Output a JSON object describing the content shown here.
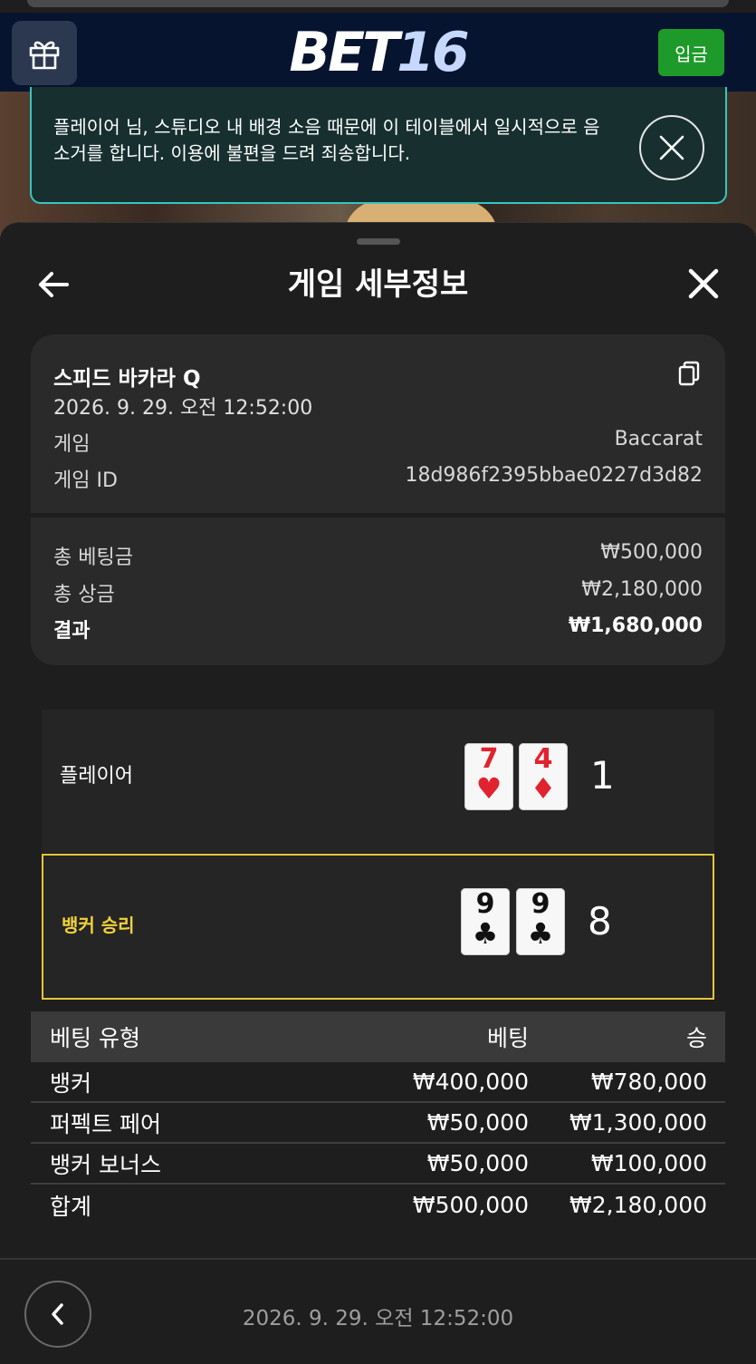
{
  "header": {
    "logo_left": "BET",
    "logo_right": "16",
    "deposit_label": "입금"
  },
  "notice": {
    "text": "플레이어 님, 스튜디오 내 배경 소음 때문에 이 테이블에서 일시적으로 음소거를 합니다. 이용에 불편을 드려 죄송합니다."
  },
  "sheet": {
    "title": "게임 세부정보"
  },
  "summary": {
    "game_name": "스피드 바카라 Q",
    "datetime": "2026. 9. 29. 오전 12:52:00",
    "game_label": "게임",
    "game_value": "Baccarat",
    "id_label": "게임 ID",
    "id_value": "18d986f2395bbae0227d3d82",
    "total_bet_label": "총 베팅금",
    "total_bet_value": "₩500,000",
    "total_win_label": "총 상금",
    "total_win_value": "₩2,180,000",
    "result_label": "결과",
    "result_value": "₩1,680,000"
  },
  "hands": {
    "player": {
      "label": "플레이어",
      "cards": [
        {
          "rank": "7",
          "suit": "♥"
        },
        {
          "rank": "4",
          "suit": "♦"
        }
      ],
      "score": "1"
    },
    "banker": {
      "label": "뱅커 승리",
      "cards": [
        {
          "rank": "9",
          "suit": "♣"
        },
        {
          "rank": "9",
          "suit": "♣"
        }
      ],
      "score": "8"
    }
  },
  "bets": {
    "headers": [
      "베팅 유형",
      "베팅",
      "승"
    ],
    "rows": [
      [
        "뱅커",
        "₩400,000",
        "₩780,000"
      ],
      [
        "퍼펙트 페어",
        "₩50,000",
        "₩1,300,000"
      ],
      [
        "뱅커 보너스",
        "₩50,000",
        "₩100,000"
      ],
      [
        "합계",
        "₩500,000",
        "₩2,180,000"
      ]
    ]
  },
  "footer": {
    "datetime": "2026. 9. 29. 오전 12:52:00"
  },
  "colors": {
    "header_bg": "#061430",
    "deposit_green": "#1e9a2a",
    "notice_border": "#36c6c0",
    "banker_highlight": "#e5c53a",
    "card_red": "#e0232e"
  }
}
